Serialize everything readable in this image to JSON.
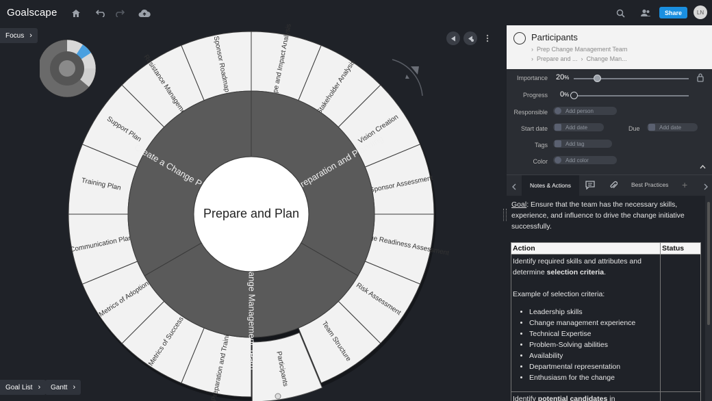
{
  "app": {
    "logo": "Goalscape",
    "share_label": "Share",
    "avatar_initials": "LN"
  },
  "toolbar": {
    "icons": [
      "home-icon",
      "undo-icon",
      "redo-icon",
      "cloud-upload-icon",
      "search-icon",
      "people-icon"
    ]
  },
  "buttons": {
    "focus_label": "Focus",
    "goal_list_label": "Goal List",
    "gantt_label": "Gantt"
  },
  "map": {
    "center": "Prepare and Plan",
    "inner_ring": [
      "Initial Preparation and Planning",
      "Prep Change Management Team",
      "Create a Change Plan"
    ],
    "outer_ring": [
      "Scope and Impact Analysis",
      "Stakeholder Analysis",
      "Vision Creation",
      "Sponsor Assessment",
      "Change Readiness Assessment",
      "Risk Assessment",
      "Team Structure",
      "Participants",
      "Preparation and Training",
      "Metrics of Success",
      "Metrics of Adoption",
      "Communication Plan",
      "Training Plan",
      "Support Plan",
      "Resistance Management",
      "Sponsor Roadmap"
    ],
    "colors": {
      "outer_segment": "#f2f2f2",
      "inner_ring": "#5a5a5a",
      "center": "#ffffff"
    }
  },
  "panel": {
    "title": "Participants",
    "breadcrumbs": [
      "Prep Change Management Team",
      "Prepare and ...",
      "Change Man..."
    ],
    "importance_label": "Importance",
    "importance_value": "20",
    "importance_unit": "%",
    "progress_label": "Progress",
    "progress_value": "0",
    "progress_unit": "%",
    "importance_fraction": 0.2,
    "progress_fraction": 0.0,
    "responsible_label": "Responsible",
    "responsible_placeholder": "Add person",
    "start_label": "Start date",
    "start_placeholder": "Add date",
    "due_label": "Due",
    "due_placeholder": "Add date",
    "tags_label": "Tags",
    "tags_placeholder": "Add tag",
    "color_label": "Color",
    "color_placeholder": "Add color",
    "tabs": {
      "notes": "Notes & Actions",
      "best": "Best Practices"
    }
  },
  "notes": {
    "goal_word": "Goal",
    "goal_text": ": Ensure that the team has the necessary skills, experience, and influence to drive the change initiative successfully.",
    "table_headers": [
      "Action",
      "Status"
    ],
    "row1_pre": "Identify required skills and attributes and determine ",
    "row1_bold": "selection criteria",
    "row1_post": ".",
    "example_text": "Example of selection criteria:",
    "criteria": [
      "Leadership skills",
      "Change management experience",
      "Technical Expertise",
      "Problem-Solving abilities",
      "Availability",
      "Departmental representation",
      "Enthusiasm for the change"
    ],
    "row2_pre": "Identify ",
    "row2_bold": "potential candidates",
    "row2_post": " in"
  }
}
